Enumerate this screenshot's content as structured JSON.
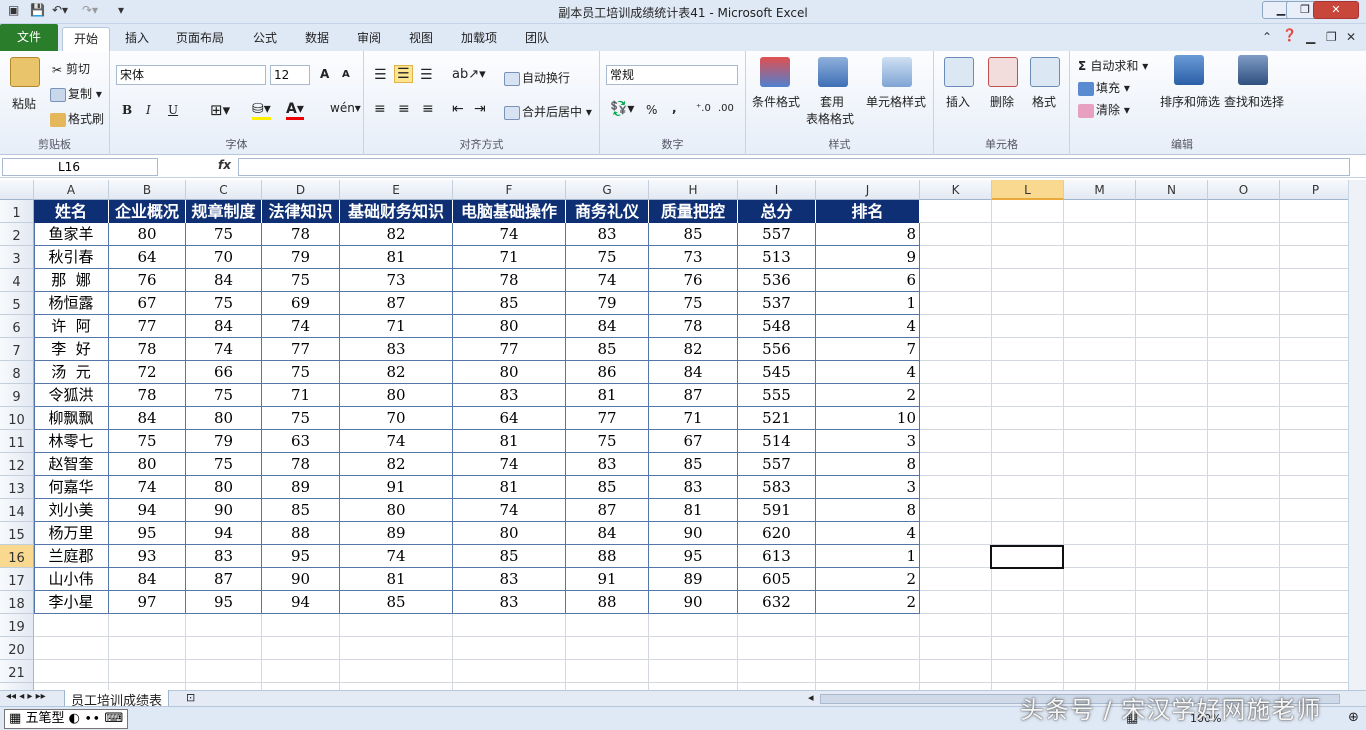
{
  "window": {
    "title": "副本员工培训成绩统计表41  -  Microsoft Excel"
  },
  "tabs": [
    "文件",
    "开始",
    "插入",
    "页面布局",
    "公式",
    "数据",
    "审阅",
    "视图",
    "加载项",
    "团队"
  ],
  "ribbon": {
    "clipboard": {
      "paste": "粘贴",
      "cut": "剪切",
      "copy": "复制",
      "painter": "格式刷",
      "label": "剪贴板"
    },
    "font": {
      "name": "宋体",
      "size": "12",
      "label": "字体",
      "bold": "B",
      "italic": "I",
      "underline": "U",
      "grow": "A",
      "shrink": "A"
    },
    "align": {
      "wrap": "自动换行",
      "merge": "合并后居中",
      "label": "对齐方式"
    },
    "number": {
      "format": "常规",
      "percent": "%",
      "comma": ",",
      "label": "数字"
    },
    "styles": {
      "cond": "条件格式",
      "table1": "套用",
      "table2": "表格格式",
      "cellstyle": "单元格样式",
      "label": "样式"
    },
    "cells": {
      "insert": "插入",
      "delete": "删除",
      "format": "格式",
      "label": "单元格"
    },
    "edit": {
      "autosum": "自动求和",
      "fill": "填充",
      "clear": "清除",
      "sort": "排序和筛选",
      "find": "查找和选择",
      "label": "编辑"
    }
  },
  "formula": {
    "namebox": "L16",
    "fx": "fx"
  },
  "columns": [
    "A",
    "B",
    "C",
    "D",
    "E",
    "F",
    "G",
    "H",
    "I",
    "J",
    "K",
    "L",
    "M",
    "N",
    "O",
    "P"
  ],
  "rows": [
    "1",
    "2",
    "3",
    "4",
    "5",
    "6",
    "7",
    "8",
    "9",
    "10",
    "11",
    "12",
    "13",
    "14",
    "15",
    "16",
    "17",
    "18",
    "19",
    "20",
    "21",
    "22"
  ],
  "table": {
    "headers": [
      "姓名",
      "企业概况",
      "规章制度",
      "法律知识",
      "基础财务知识",
      "电脑基础操作",
      "商务礼仪",
      "质量把控",
      "总分",
      "排名"
    ],
    "rows": [
      [
        "鱼家羊",
        "80",
        "75",
        "78",
        "82",
        "74",
        "83",
        "85",
        "557",
        "8"
      ],
      [
        "秋引春",
        "64",
        "70",
        "79",
        "81",
        "71",
        "75",
        "73",
        "513",
        "9"
      ],
      [
        "那  娜",
        "76",
        "84",
        "75",
        "73",
        "78",
        "74",
        "76",
        "536",
        "6"
      ],
      [
        "杨恒露",
        "67",
        "75",
        "69",
        "87",
        "85",
        "79",
        "75",
        "537",
        "1"
      ],
      [
        "许  阿",
        "77",
        "84",
        "74",
        "71",
        "80",
        "84",
        "78",
        "548",
        "4"
      ],
      [
        "李  好",
        "78",
        "74",
        "77",
        "83",
        "77",
        "85",
        "82",
        "556",
        "7"
      ],
      [
        "汤  元",
        "72",
        "66",
        "75",
        "82",
        "80",
        "86",
        "84",
        "545",
        "4"
      ],
      [
        "令狐洪",
        "78",
        "75",
        "71",
        "80",
        "83",
        "81",
        "87",
        "555",
        "2"
      ],
      [
        "柳飘飘",
        "84",
        "80",
        "75",
        "70",
        "64",
        "77",
        "71",
        "521",
        "10"
      ],
      [
        "林零七",
        "75",
        "79",
        "63",
        "74",
        "81",
        "75",
        "67",
        "514",
        "3"
      ],
      [
        "赵智奎",
        "80",
        "75",
        "78",
        "82",
        "74",
        "83",
        "85",
        "557",
        "8"
      ],
      [
        "何嘉华",
        "74",
        "80",
        "89",
        "91",
        "81",
        "85",
        "83",
        "583",
        "3"
      ],
      [
        "刘小美",
        "94",
        "90",
        "85",
        "80",
        "74",
        "87",
        "81",
        "591",
        "8"
      ],
      [
        "杨万里",
        "95",
        "94",
        "88",
        "89",
        "80",
        "84",
        "90",
        "620",
        "4"
      ],
      [
        "兰庭郡",
        "93",
        "83",
        "95",
        "74",
        "85",
        "88",
        "95",
        "613",
        "1"
      ],
      [
        "山小伟",
        "84",
        "87",
        "90",
        "81",
        "83",
        "91",
        "89",
        "605",
        "2"
      ],
      [
        "李小星",
        "97",
        "95",
        "94",
        "85",
        "83",
        "88",
        "90",
        "632",
        "2"
      ]
    ]
  },
  "sheet_tab": "员工培训成绩表",
  "ime": "五笔型",
  "status": {
    "zoom": "100%"
  },
  "watermark": "头条号 / 宋汉学好网施老师"
}
